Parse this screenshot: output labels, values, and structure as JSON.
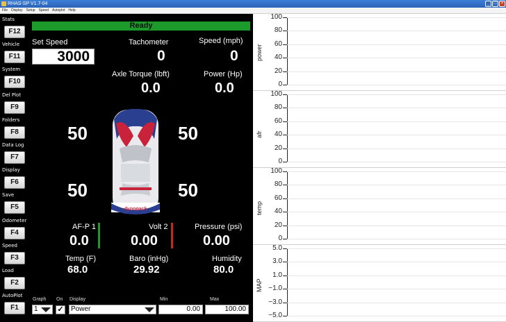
{
  "window": {
    "title": "RHAS-SP V1.7-04",
    "controls": [
      "_",
      "□",
      "×"
    ]
  },
  "menu": [
    "File",
    "Display",
    "Setup",
    "Speed",
    "Autoplot",
    "Help"
  ],
  "fkeys": [
    {
      "label": "Stats",
      "key": "F12"
    },
    {
      "label": "Vehicle",
      "key": "F11"
    },
    {
      "label": "System",
      "key": "F10"
    },
    {
      "label": "Del Plot",
      "key": "F9"
    },
    {
      "label": "Folders",
      "key": "F8"
    },
    {
      "label": "Data Log",
      "key": "F7"
    },
    {
      "label": "Display",
      "key": "F6"
    },
    {
      "label": "Save",
      "key": "F5"
    },
    {
      "label": "Odometer",
      "key": "F4"
    },
    {
      "label": "Speed",
      "key": "F3"
    },
    {
      "label": "Load",
      "key": "F2"
    },
    {
      "label": "AutoPlot",
      "key": "F1"
    }
  ],
  "status": "Ready",
  "gauges": {
    "set_speed": {
      "label": "Set Speed",
      "value": "3000"
    },
    "tachometer": {
      "label": "Tachometer",
      "value": "0"
    },
    "speed": {
      "label": "Speed (mph)",
      "value": "0"
    },
    "axle_torque": {
      "label": "Axle Torque (lbft)",
      "value": "0.0"
    },
    "power": {
      "label": "Power (Hp)",
      "value": "0.0"
    },
    "wheel_fl": "50",
    "wheel_fr": "50",
    "wheel_rl": "50",
    "wheel_rr": "50",
    "afp1": {
      "label": "AF-P 1",
      "value": "0.0"
    },
    "volt2": {
      "label": "Volt 2",
      "value": "0.00"
    },
    "pressure": {
      "label": "Pressure (psi)",
      "value": "0.00"
    },
    "temp": {
      "label": "Temp (F)",
      "value": "68.0"
    },
    "baro": {
      "label": "Baro (inHg)",
      "value": "29.92"
    },
    "humidity": {
      "label": "Humidity",
      "value": "80.0"
    }
  },
  "car_logo": "dynopack",
  "graph_controls": {
    "graph_label": "Graph",
    "graph_value": "1",
    "on_label": "On",
    "on_checked": true,
    "display_label": "Display",
    "display_value": "Power",
    "min_label": "Min",
    "min_value": "0.00",
    "max_label": "Max",
    "max_value": "100.00"
  },
  "plots": [
    {
      "name": "power",
      "ticks": [
        "100",
        "80",
        "60",
        "40",
        "20",
        "0"
      ]
    },
    {
      "name": "afr",
      "ticks": [
        "100",
        "80",
        "60",
        "40",
        "20",
        "0"
      ]
    },
    {
      "name": "temp",
      "ticks": [
        "100",
        "80",
        "60",
        "40",
        "20",
        "0"
      ]
    },
    {
      "name": "MAP",
      "ticks": [
        "5.0",
        "3.0",
        "1.0",
        "−1.0",
        "−3.0",
        "−5.0"
      ]
    }
  ],
  "colors": {
    "status_green": "#1c9a2c",
    "volt_bar_red": "#d12222",
    "titlebar_blue": "#2a63b8"
  }
}
